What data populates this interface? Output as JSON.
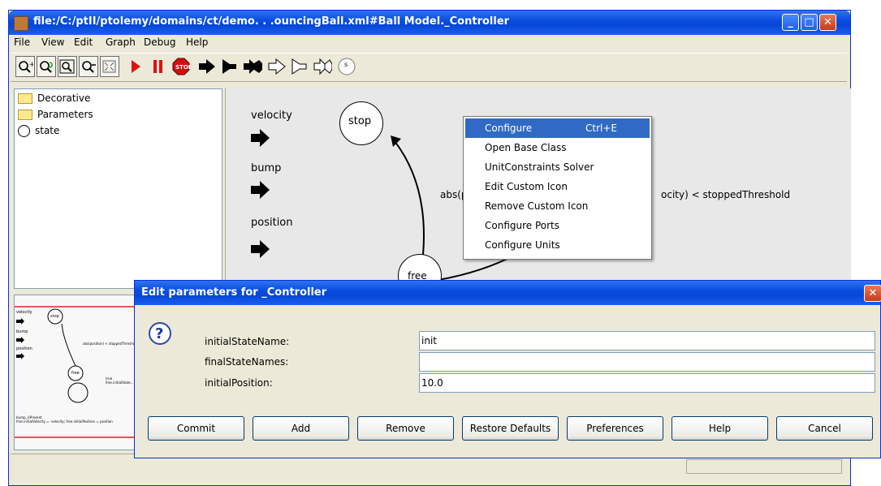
{
  "window": {
    "title": "file:/C:/ptII/ptolemy/domains/ct/demo. . .ouncingBall.xml#Ball Model._Controller",
    "minimize_glyph": "_",
    "maximize_glyph": "□",
    "close_glyph": "✕"
  },
  "menubar": [
    "File",
    "View",
    "Edit",
    "Graph",
    "Debug",
    "Help"
  ],
  "toolbar": {
    "buttons": [
      "zoom-in-icon",
      "zoom-reset-icon",
      "zoom-fit-icon",
      "zoom-out-icon",
      "fullscreen-icon",
      "run-icon",
      "pause-icon",
      "stop-icon",
      "input-port-icon",
      "output-port-icon",
      "input-output-port-icon",
      "input-multiport-icon",
      "output-multiport-icon",
      "io-multiport-icon",
      "state-icon"
    ],
    "state_button_label": "s"
  },
  "tree": {
    "items": [
      {
        "label": "Decorative",
        "icon": "folder-icon"
      },
      {
        "label": "Parameters",
        "icon": "folder-icon"
      },
      {
        "label": "state",
        "icon": "state-icon"
      }
    ]
  },
  "canvas": {
    "ports": [
      "velocity",
      "bump",
      "position"
    ],
    "states": {
      "stop": "stop",
      "free": "free"
    },
    "transition_left_label": "abs(po",
    "transition_right_label": "ocity) < stoppedThreshold"
  },
  "overview": {
    "ports": [
      "velocity",
      "bump",
      "position"
    ],
    "states": [
      "stop",
      "free"
    ],
    "left_label": "abs(position) < stoppedThreshold",
    "free_label": "true\nfree.initialState...",
    "bottom_label": "bump_isPresent\nfree.initialVelocity = -velocity; free.initialPosition = position"
  },
  "context_menu": {
    "items": [
      {
        "label": "Configure",
        "accelerator": "Ctrl+E",
        "selected": true
      },
      {
        "label": "Open Base Class",
        "accelerator": ""
      },
      {
        "label": "UnitConstraints Solver",
        "accelerator": ""
      },
      {
        "label": "Edit Custom Icon",
        "accelerator": ""
      },
      {
        "label": "Remove Custom Icon",
        "accelerator": ""
      },
      {
        "label": "Configure Ports",
        "accelerator": ""
      },
      {
        "label": "Configure Units",
        "accelerator": ""
      }
    ]
  },
  "dialog": {
    "title": "Edit parameters for _Controller",
    "close_glyph": "✕",
    "icon": "question-icon",
    "params": [
      {
        "label": "initialStateName:",
        "value": "init"
      },
      {
        "label": "finalStateNames:",
        "value": ""
      },
      {
        "label": "initialPosition:",
        "value": "10.0"
      }
    ],
    "buttons": [
      "Commit",
      "Add",
      "Remove",
      "Restore Defaults",
      "Preferences",
      "Help",
      "Cancel"
    ]
  },
  "colors": {
    "titlebar": "#0a4de0",
    "selection": "#316ac5",
    "window_bg": "#ece9d8",
    "canvas_bg": "#e8e8e8",
    "red_line": "#e02020"
  }
}
